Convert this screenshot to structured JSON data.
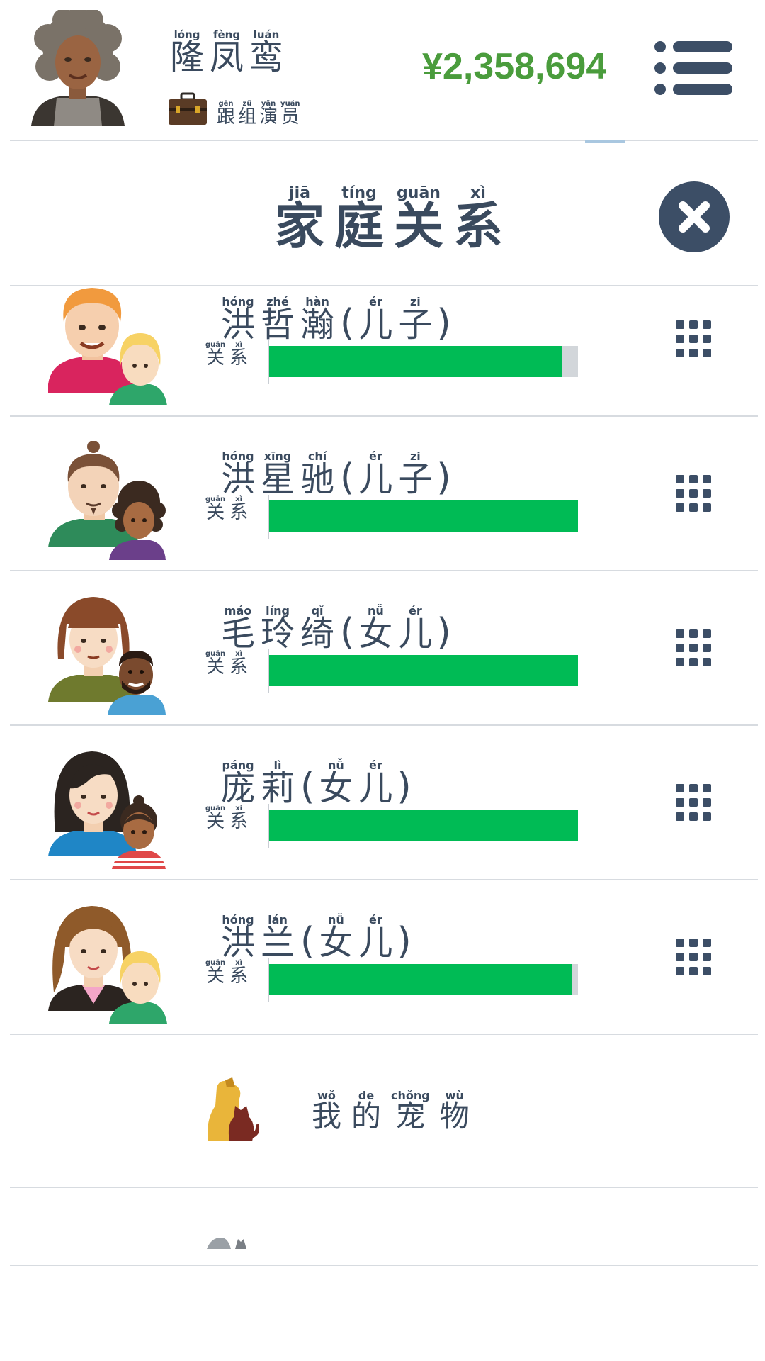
{
  "header": {
    "player_name": [
      {
        "py": "lóng",
        "ch": "隆"
      },
      {
        "py": "fèng",
        "ch": "凤"
      },
      {
        "py": "luán",
        "ch": "鸾"
      }
    ],
    "job": [
      {
        "py": "gēn",
        "ch": "跟"
      },
      {
        "py": "zǔ",
        "ch": "组"
      },
      {
        "py": "yǎn",
        "ch": "演"
      },
      {
        "py": "yuán",
        "ch": "员"
      }
    ],
    "money": "¥2,358,694",
    "money_color": "#4a9c3c",
    "menu_icon": "list-menu-icon"
  },
  "title": [
    {
      "py": "jiā",
      "ch": "家"
    },
    {
      "py": "tíng",
      "ch": "庭"
    },
    {
      "py": "guān",
      "ch": "关"
    },
    {
      "py": "xì",
      "ch": "系"
    }
  ],
  "relation_label": [
    {
      "py": "guān",
      "ch": "关"
    },
    {
      "py": "xì",
      "ch": "系"
    }
  ],
  "family": [
    {
      "name": [
        {
          "py": "hóng",
          "ch": "洪"
        },
        {
          "py": "zhé",
          "ch": "哲"
        },
        {
          "py": "hàn",
          "ch": "瀚"
        }
      ],
      "relation": [
        {
          "py": "ér",
          "ch": "儿"
        },
        {
          "py": "zi",
          "ch": "子"
        }
      ],
      "relationship": 0.95
    },
    {
      "name": [
        {
          "py": "hóng",
          "ch": "洪"
        },
        {
          "py": "xīng",
          "ch": "星"
        },
        {
          "py": "chí",
          "ch": "驰"
        }
      ],
      "relation": [
        {
          "py": "ér",
          "ch": "儿"
        },
        {
          "py": "zi",
          "ch": "子"
        }
      ],
      "relationship": 1.0
    },
    {
      "name": [
        {
          "py": "máo",
          "ch": "毛"
        },
        {
          "py": "líng",
          "ch": "玲"
        },
        {
          "py": "qǐ",
          "ch": "绮"
        }
      ],
      "relation": [
        {
          "py": "nǚ",
          "ch": "女"
        },
        {
          "py": "ér",
          "ch": "儿"
        }
      ],
      "relationship": 1.0
    },
    {
      "name": [
        {
          "py": "páng",
          "ch": "庞"
        },
        {
          "py": "lì",
          "ch": "莉"
        }
      ],
      "relation": [
        {
          "py": "nǚ",
          "ch": "女"
        },
        {
          "py": "ér",
          "ch": "儿"
        }
      ],
      "relationship": 1.0
    },
    {
      "name": [
        {
          "py": "hóng",
          "ch": "洪"
        },
        {
          "py": "lán",
          "ch": "兰"
        }
      ],
      "relation": [
        {
          "py": "nǚ",
          "ch": "女"
        },
        {
          "py": "ér",
          "ch": "儿"
        }
      ],
      "relationship": 0.98
    }
  ],
  "pets": [
    {
      "py": "wǒ",
      "ch": "我"
    },
    {
      "py": "de",
      "ch": "的"
    },
    {
      "py": "chǒng",
      "ch": "宠"
    },
    {
      "py": "wù",
      "ch": "物"
    }
  ],
  "colors": {
    "text": "#3a4a5e",
    "bar_fill": "#00bb55",
    "bar_track": "#d2d6da",
    "button_dark": "#3c4e66"
  }
}
